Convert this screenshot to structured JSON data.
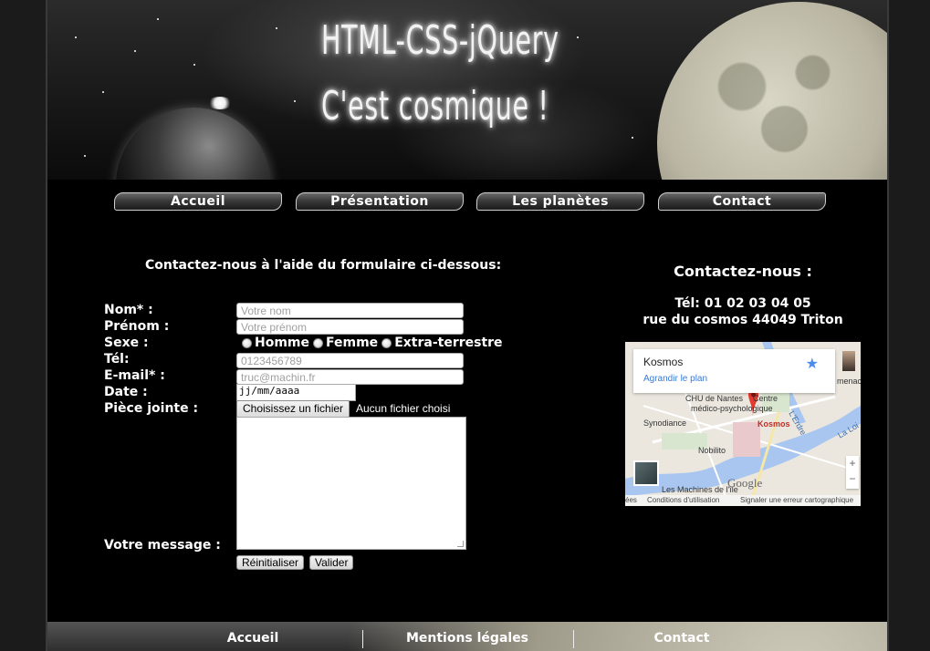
{
  "banner": {
    "title_line1": "HTML-CSS-jQuery",
    "title_line2": "C'est cosmique !"
  },
  "nav": {
    "items": [
      {
        "label": "Accueil"
      },
      {
        "label": "Présentation"
      },
      {
        "label": "Les planètes"
      },
      {
        "label": "Contact"
      }
    ]
  },
  "form": {
    "heading": "Contactez-nous à l'aide du formulaire ci-dessous:",
    "labels": {
      "nom": "Nom* :",
      "prenom": "Prénom :",
      "sexe": "Sexe :",
      "tel": "Tél:",
      "email": "E-mail* :",
      "date": "Date :",
      "piece_jointe": "Pièce jointe :",
      "message": "Votre message :"
    },
    "placeholders": {
      "nom": "Votre nom",
      "prenom": "Votre prénom",
      "tel": "0123456789",
      "email": "truc@machin.fr"
    },
    "date_value": "jj/mm/aaaa",
    "sexe_options": [
      "Homme",
      "Femme",
      "Extra-terrestre"
    ],
    "file_button": "Choisissez un fichier",
    "file_status": "Aucun fichier choisi",
    "reset_button": "Réinitialiser",
    "submit_button": "Valider"
  },
  "contact": {
    "heading": "Contactez-nous :",
    "phone": "Tél: 01 02 03 04 05",
    "address": "rue du cosmos 44049 Triton"
  },
  "map": {
    "card_title": "Kosmos",
    "card_link": "Agrandir le plan",
    "pin_label": "Kosmos",
    "places": {
      "chu": "CHU de Nantes",
      "centre": "Centre",
      "medico": "médico-psychologique",
      "synodiance": "Synodiance",
      "nobilito": "Nobilito",
      "machines": "Les Machines de l'île",
      "erdre": "L'Erdre",
      "loire": "La Loi",
      "menace": "menace",
      "google": "Google"
    },
    "footer": {
      "left": "ées",
      "terms": "Conditions d'utilisation",
      "report": "Signaler une erreur cartographique"
    },
    "zoom_in": "+",
    "zoom_out": "−",
    "colors": {
      "water": "#a8c6ef",
      "pin": "#e53a2f",
      "link": "#3a7bd5"
    }
  },
  "footer": {
    "items": [
      {
        "label": "Accueil"
      },
      {
        "label": "Mentions légales"
      },
      {
        "label": "Contact"
      }
    ]
  }
}
